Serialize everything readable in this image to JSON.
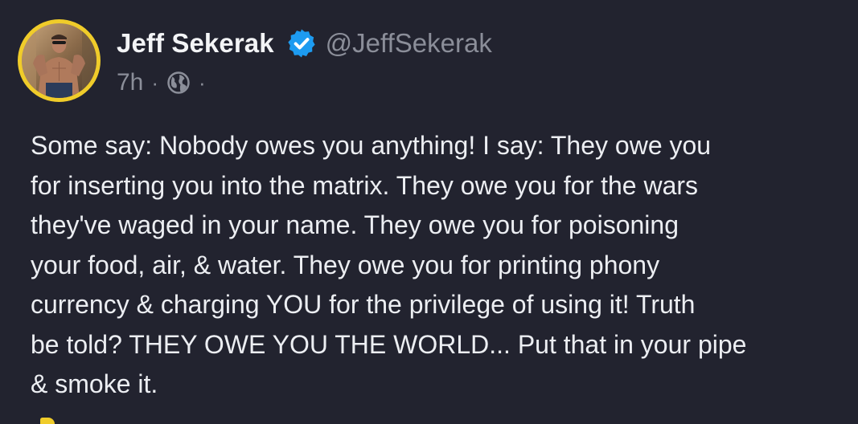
{
  "author": {
    "display_name": "Jeff Sekerak",
    "handle": "@JeffSekerak",
    "verified": true
  },
  "meta": {
    "timestamp": "7h",
    "separator": "·",
    "visibility_icon": "globe-icon",
    "trailing_separator": "·"
  },
  "post": {
    "lines": [
      "Some say: Nobody owes you anything! I say: They owe you",
      "for inserting you into the matrix. They owe you for the wars",
      "they've waged in your name. They owe you for poisoning",
      "your food, air, & water. They owe you for printing phony",
      "currency & charging YOU for the privilege of using it! Truth",
      "be told? THEY OWE YOU THE WORLD... Put that in your pipe",
      "& smoke it."
    ]
  },
  "colors": {
    "background": "#22232f",
    "avatar_ring": "#f0cc2a",
    "verified_badge": "#1d9bf0",
    "secondary_text": "#8b8e99"
  }
}
